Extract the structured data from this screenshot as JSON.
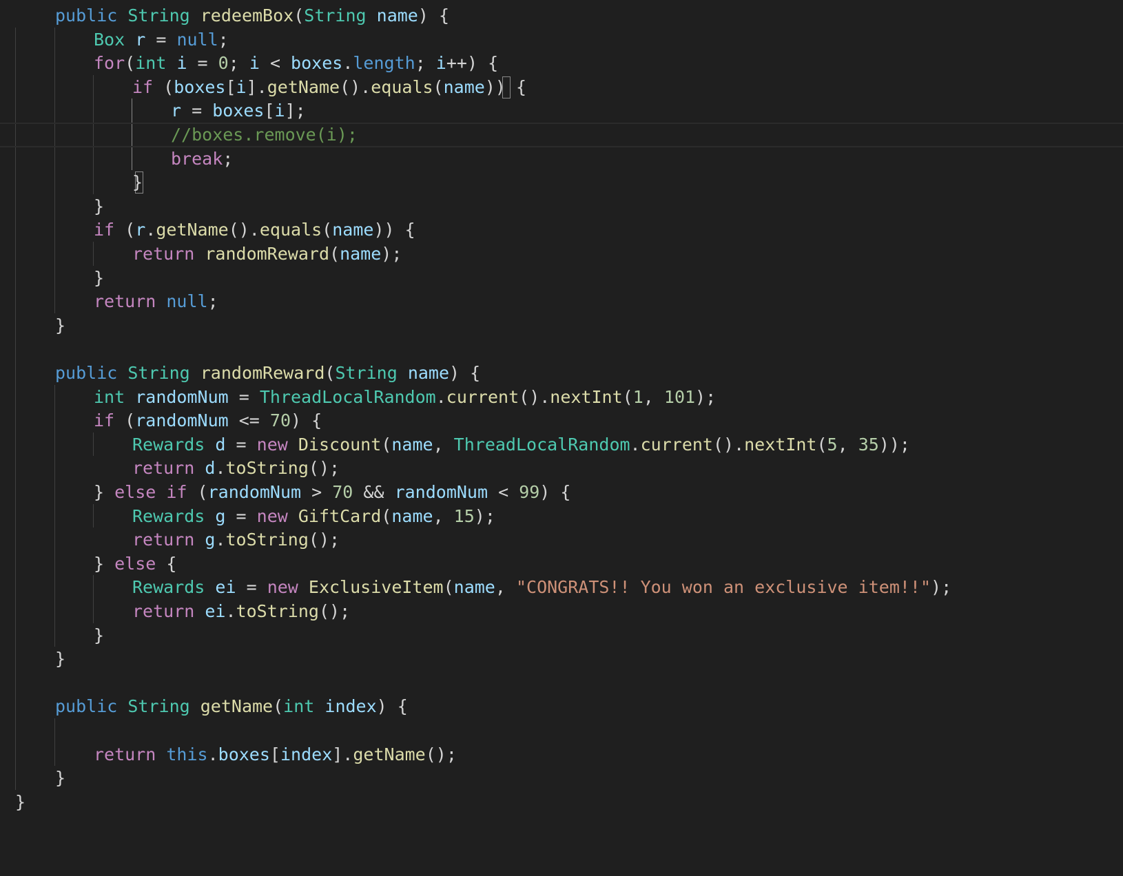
{
  "colors": {
    "background": "#1f1f1f",
    "keyword": "#569cd6",
    "control": "#c586c0",
    "type": "#4ec9b0",
    "function": "#dcdcaa",
    "variable": "#9cdcfe",
    "number": "#b5cea8",
    "string": "#ce9178",
    "comment": "#6a9955",
    "punctuation": "#d4d4d4"
  },
  "editor": {
    "lines": [
      {
        "tokens": [
          [
            "public",
            "keyword"
          ],
          [
            " ",
            "p"
          ],
          [
            "String",
            "type"
          ],
          [
            " ",
            "p"
          ],
          [
            "redeemBox",
            "function"
          ],
          [
            "(",
            "p"
          ],
          [
            "String",
            "type"
          ],
          [
            " ",
            "p"
          ],
          [
            "name",
            "variable"
          ],
          [
            ") {",
            "p"
          ]
        ]
      },
      {
        "tokens": [
          [
            "Box",
            "type"
          ],
          [
            " ",
            "p"
          ],
          [
            "r",
            "variable"
          ],
          [
            " = ",
            "p"
          ],
          [
            "null",
            "keyword"
          ],
          [
            ";",
            "p"
          ]
        ]
      },
      {
        "tokens": [
          [
            "for",
            "control"
          ],
          [
            "(",
            "p"
          ],
          [
            "int",
            "type"
          ],
          [
            " ",
            "p"
          ],
          [
            "i",
            "variable"
          ],
          [
            " = ",
            "p"
          ],
          [
            "0",
            "number"
          ],
          [
            "; ",
            "p"
          ],
          [
            "i",
            "variable"
          ],
          [
            " < ",
            "p"
          ],
          [
            "boxes",
            "variable"
          ],
          [
            ".",
            "p"
          ],
          [
            "length",
            "keyword"
          ],
          [
            "; ",
            "p"
          ],
          [
            "i",
            "variable"
          ],
          [
            "++) {",
            "p"
          ]
        ]
      },
      {
        "tokens": [
          [
            "if",
            "control"
          ],
          [
            " (",
            "p"
          ],
          [
            "boxes",
            "variable"
          ],
          [
            "[",
            "p"
          ],
          [
            "i",
            "variable"
          ],
          [
            "].",
            "p"
          ],
          [
            "getName",
            "function"
          ],
          [
            "().",
            "p"
          ],
          [
            "equals",
            "function"
          ],
          [
            "(",
            "p"
          ],
          [
            "name",
            "variable"
          ],
          [
            ")) ",
            "p"
          ],
          [
            "{",
            "p"
          ]
        ]
      },
      {
        "tokens": [
          [
            "r",
            "variable"
          ],
          [
            " = ",
            "p"
          ],
          [
            "boxes",
            "variable"
          ],
          [
            "[",
            "p"
          ],
          [
            "i",
            "variable"
          ],
          [
            "];",
            "p"
          ]
        ]
      },
      {
        "tokens": [
          [
            "//boxes.remove(i);",
            "comment"
          ]
        ]
      },
      {
        "tokens": [
          [
            "break",
            "control"
          ],
          [
            ";",
            "p"
          ]
        ]
      },
      {
        "tokens": [
          [
            "}",
            "p"
          ]
        ]
      },
      {
        "tokens": [
          [
            "}",
            "p"
          ]
        ]
      },
      {
        "tokens": [
          [
            "if",
            "control"
          ],
          [
            " (",
            "p"
          ],
          [
            "r",
            "variable"
          ],
          [
            ".",
            "p"
          ],
          [
            "getName",
            "function"
          ],
          [
            "().",
            "p"
          ],
          [
            "equals",
            "function"
          ],
          [
            "(",
            "p"
          ],
          [
            "name",
            "variable"
          ],
          [
            ")) {",
            "p"
          ]
        ]
      },
      {
        "tokens": [
          [
            "return",
            "control"
          ],
          [
            " ",
            "p"
          ],
          [
            "randomReward",
            "function"
          ],
          [
            "(",
            "p"
          ],
          [
            "name",
            "variable"
          ],
          [
            ");",
            "p"
          ]
        ]
      },
      {
        "tokens": [
          [
            "}",
            "p"
          ]
        ]
      },
      {
        "tokens": [
          [
            "return",
            "control"
          ],
          [
            " ",
            "p"
          ],
          [
            "null",
            "keyword"
          ],
          [
            ";",
            "p"
          ]
        ]
      },
      {
        "tokens": [
          [
            "}",
            "p"
          ]
        ]
      },
      {
        "tokens": []
      },
      {
        "tokens": [
          [
            "public",
            "keyword"
          ],
          [
            " ",
            "p"
          ],
          [
            "String",
            "type"
          ],
          [
            " ",
            "p"
          ],
          [
            "randomReward",
            "function"
          ],
          [
            "(",
            "p"
          ],
          [
            "String",
            "type"
          ],
          [
            " ",
            "p"
          ],
          [
            "name",
            "variable"
          ],
          [
            ") {",
            "p"
          ]
        ]
      },
      {
        "tokens": [
          [
            "int",
            "type"
          ],
          [
            " ",
            "p"
          ],
          [
            "randomNum",
            "variable"
          ],
          [
            " = ",
            "p"
          ],
          [
            "ThreadLocalRandom",
            "type"
          ],
          [
            ".",
            "p"
          ],
          [
            "current",
            "function"
          ],
          [
            "().",
            "p"
          ],
          [
            "nextInt",
            "function"
          ],
          [
            "(",
            "p"
          ],
          [
            "1",
            "number"
          ],
          [
            ", ",
            "p"
          ],
          [
            "101",
            "number"
          ],
          [
            ");",
            "p"
          ]
        ]
      },
      {
        "tokens": [
          [
            "if",
            "control"
          ],
          [
            " (",
            "p"
          ],
          [
            "randomNum",
            "variable"
          ],
          [
            " <= ",
            "p"
          ],
          [
            "70",
            "number"
          ],
          [
            ") {",
            "p"
          ]
        ]
      },
      {
        "tokens": [
          [
            "Rewards",
            "type"
          ],
          [
            " ",
            "p"
          ],
          [
            "d",
            "variable"
          ],
          [
            " = ",
            "p"
          ],
          [
            "new",
            "control"
          ],
          [
            " ",
            "p"
          ],
          [
            "Discount",
            "function"
          ],
          [
            "(",
            "p"
          ],
          [
            "name",
            "variable"
          ],
          [
            ", ",
            "p"
          ],
          [
            "ThreadLocalRandom",
            "type"
          ],
          [
            ".",
            "p"
          ],
          [
            "current",
            "function"
          ],
          [
            "().",
            "p"
          ],
          [
            "nextInt",
            "function"
          ],
          [
            "(",
            "p"
          ],
          [
            "5",
            "number"
          ],
          [
            ", ",
            "p"
          ],
          [
            "35",
            "number"
          ],
          [
            "));",
            "p"
          ]
        ]
      },
      {
        "tokens": [
          [
            "return",
            "control"
          ],
          [
            " ",
            "p"
          ],
          [
            "d",
            "variable"
          ],
          [
            ".",
            "p"
          ],
          [
            "toString",
            "function"
          ],
          [
            "();",
            "p"
          ]
        ]
      },
      {
        "tokens": [
          [
            "} ",
            "p"
          ],
          [
            "else",
            "control"
          ],
          [
            " ",
            "p"
          ],
          [
            "if",
            "control"
          ],
          [
            " (",
            "p"
          ],
          [
            "randomNum",
            "variable"
          ],
          [
            " > ",
            "p"
          ],
          [
            "70",
            "number"
          ],
          [
            " && ",
            "p"
          ],
          [
            "randomNum",
            "variable"
          ],
          [
            " < ",
            "p"
          ],
          [
            "99",
            "number"
          ],
          [
            ") {",
            "p"
          ]
        ]
      },
      {
        "tokens": [
          [
            "Rewards",
            "type"
          ],
          [
            " ",
            "p"
          ],
          [
            "g",
            "variable"
          ],
          [
            " = ",
            "p"
          ],
          [
            "new",
            "control"
          ],
          [
            " ",
            "p"
          ],
          [
            "GiftCard",
            "function"
          ],
          [
            "(",
            "p"
          ],
          [
            "name",
            "variable"
          ],
          [
            ", ",
            "p"
          ],
          [
            "15",
            "number"
          ],
          [
            ");",
            "p"
          ]
        ]
      },
      {
        "tokens": [
          [
            "return",
            "control"
          ],
          [
            " ",
            "p"
          ],
          [
            "g",
            "variable"
          ],
          [
            ".",
            "p"
          ],
          [
            "toString",
            "function"
          ],
          [
            "();",
            "p"
          ]
        ]
      },
      {
        "tokens": [
          [
            "} ",
            "p"
          ],
          [
            "else",
            "control"
          ],
          [
            " {",
            "p"
          ]
        ]
      },
      {
        "tokens": [
          [
            "Rewards",
            "type"
          ],
          [
            " ",
            "p"
          ],
          [
            "ei",
            "variable"
          ],
          [
            " = ",
            "p"
          ],
          [
            "new",
            "control"
          ],
          [
            " ",
            "p"
          ],
          [
            "ExclusiveItem",
            "function"
          ],
          [
            "(",
            "p"
          ],
          [
            "name",
            "variable"
          ],
          [
            ", ",
            "p"
          ],
          [
            "\"CONGRATS!! You won an exclusive item!!\"",
            "string"
          ],
          [
            ");",
            "p"
          ]
        ]
      },
      {
        "tokens": [
          [
            "return",
            "control"
          ],
          [
            " ",
            "p"
          ],
          [
            "ei",
            "variable"
          ],
          [
            ".",
            "p"
          ],
          [
            "toString",
            "function"
          ],
          [
            "();",
            "p"
          ]
        ]
      },
      {
        "tokens": [
          [
            "}",
            "p"
          ]
        ]
      },
      {
        "tokens": [
          [
            "}",
            "p"
          ]
        ]
      },
      {
        "tokens": []
      },
      {
        "tokens": [
          [
            "public",
            "keyword"
          ],
          [
            " ",
            "p"
          ],
          [
            "String",
            "type"
          ],
          [
            " ",
            "p"
          ],
          [
            "getName",
            "function"
          ],
          [
            "(",
            "p"
          ],
          [
            "int",
            "type"
          ],
          [
            " ",
            "p"
          ],
          [
            "index",
            "variable"
          ],
          [
            ") {",
            "p"
          ]
        ]
      },
      {
        "tokens": []
      },
      {
        "tokens": [
          [
            "return",
            "control"
          ],
          [
            " ",
            "p"
          ],
          [
            "this",
            "keyword"
          ],
          [
            ".",
            "p"
          ],
          [
            "boxes",
            "variable"
          ],
          [
            "[",
            "p"
          ],
          [
            "index",
            "variable"
          ],
          [
            "].",
            "p"
          ],
          [
            "getName",
            "function"
          ],
          [
            "();",
            "p"
          ]
        ]
      },
      {
        "tokens": [
          [
            "}",
            "p"
          ]
        ]
      },
      {
        "tokens": [
          [
            "}",
            "p"
          ]
        ]
      }
    ]
  }
}
